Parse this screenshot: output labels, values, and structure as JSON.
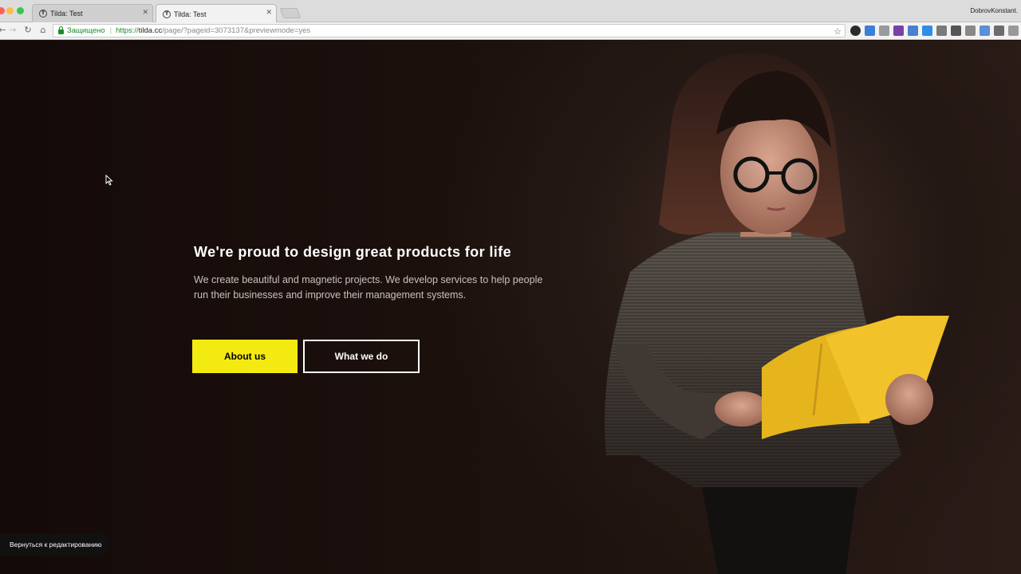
{
  "browser": {
    "tabs": [
      {
        "title": "Tilda: Test",
        "favicon": "T",
        "active": false
      },
      {
        "title": "Tilda: Test",
        "favicon": "T",
        "active": true
      }
    ],
    "profile_name": "DobrovKonstant.",
    "address_bar": {
      "secure_label": "Защищено",
      "url_scheme": "https://",
      "url_host": "tilda.cc",
      "url_path": "/page/?pageid=3073137&previewmode=yes"
    },
    "icons": {
      "back": "back-arrow-icon",
      "forward": "forward-arrow-icon",
      "reload": "reload-icon",
      "home": "home-icon",
      "bookmark": "star-icon"
    }
  },
  "hero": {
    "title": "We're proud to design great products for life",
    "description": "We create beautiful and magnetic projects. We develop services to help people run their businesses and improve their management systems.",
    "primary_button": "About us",
    "secondary_button": "What we do",
    "accent_color": "#f3ea12"
  },
  "editor": {
    "back_label": "Вернуться к редактированию"
  }
}
